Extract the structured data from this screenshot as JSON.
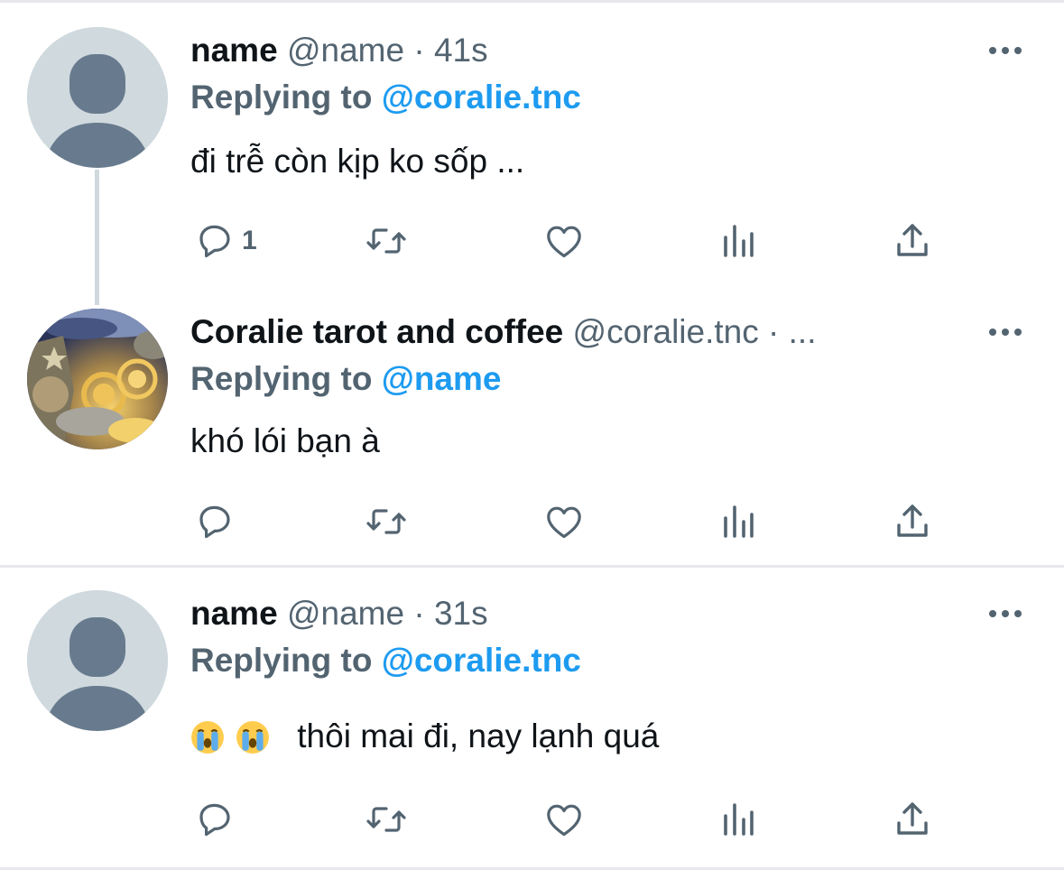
{
  "tweets": [
    {
      "name": "name",
      "handle": "@name",
      "sep": "·",
      "time": "41s",
      "replying_prefix": "Replying to",
      "replying_handle": "@coralie.tnc",
      "text": "đi trễ còn kịp ko sốp ...",
      "reply_count": "1",
      "avatar": "default-avatar"
    },
    {
      "name": "Coralie tarot and coffee",
      "handle": "@coralie.tnc",
      "sep": "· ...",
      "replying_prefix": "Replying to",
      "replying_handle": "@name",
      "text": "khó lói bạn à",
      "avatar": "celestial-art-avatar"
    },
    {
      "name": "name",
      "handle": "@name",
      "sep": "·",
      "time": "31s",
      "replying_prefix": "Replying to",
      "replying_handle": "@coralie.tnc",
      "emojis": [
        "crying-face-emoji",
        "crying-face-emoji"
      ],
      "text": "thôi mai đi, nay lạnh quá",
      "avatar": "default-avatar"
    }
  ],
  "colors": {
    "accent": "#1d9bf0",
    "muted": "#536471",
    "text": "#0f1419",
    "avatar_bg": "#cfd9de",
    "avatar_fg": "#687b8e",
    "divider": "#e6e8eb"
  },
  "icons": [
    "reply-icon",
    "retweet-icon",
    "like-icon",
    "analytics-icon",
    "share-icon",
    "more-icon"
  ]
}
